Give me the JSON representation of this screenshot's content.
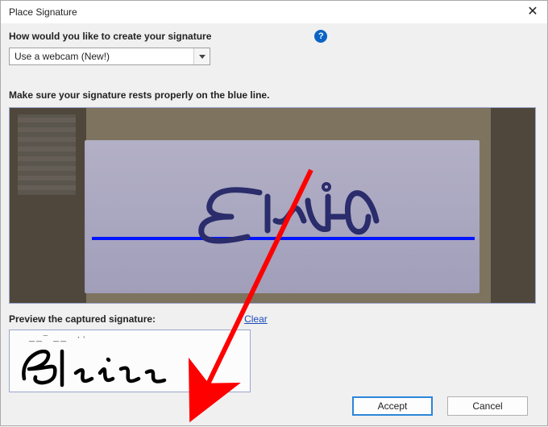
{
  "window": {
    "title": "Place Signature"
  },
  "prompt": "How would you like to create your signature",
  "dropdown": {
    "selected": "Use a webcam (New!)"
  },
  "instruction": "Make sure your signature rests properly on the blue line.",
  "preview": {
    "label": "Preview the captured signature:",
    "clear": "Clear"
  },
  "signature": {
    "name_text": "Elsie"
  },
  "buttons": {
    "accept": "Accept",
    "cancel": "Cancel"
  },
  "colors": {
    "guide_line": "#0014ff",
    "accent": "#2b86d9",
    "annotation": "#ff0000"
  }
}
